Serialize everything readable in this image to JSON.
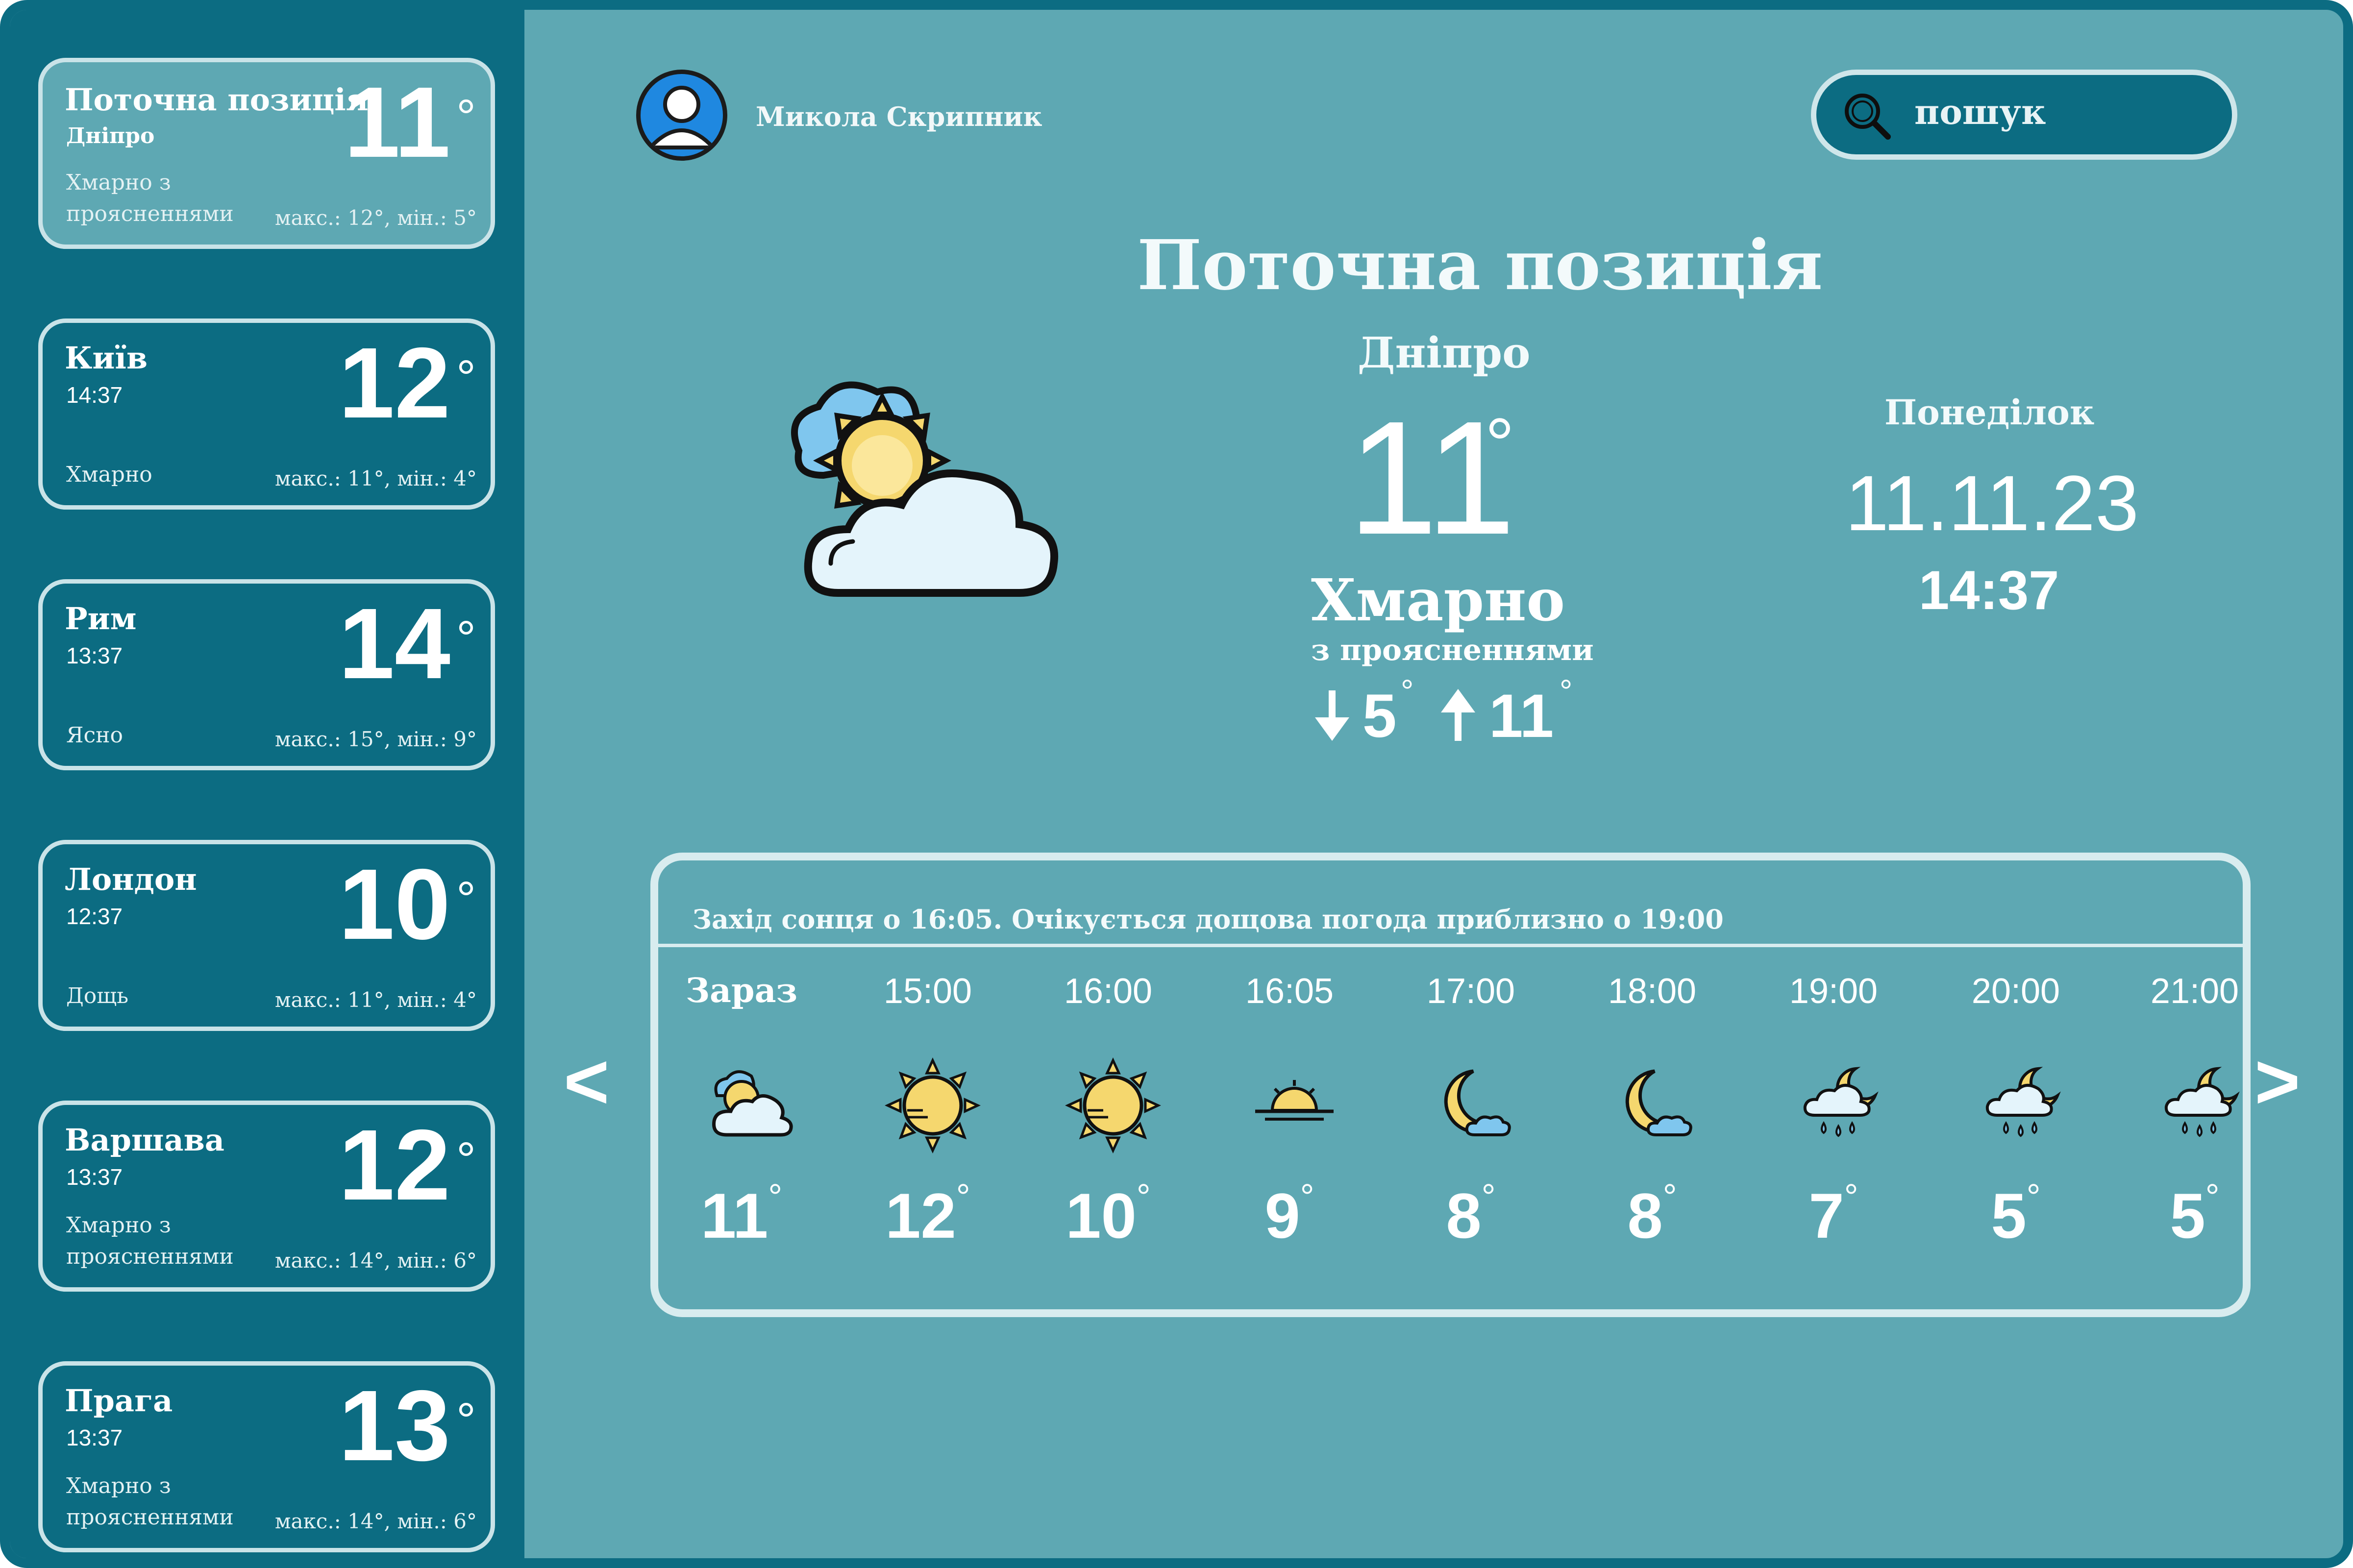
{
  "user": {
    "name": "Микола Скрипник"
  },
  "search": {
    "placeholder": "пошук"
  },
  "current": {
    "title": "Поточна позиція",
    "city": "Дніпро",
    "temp": "11",
    "condition": "Хмарно",
    "condition_detail": "з проясненнями",
    "min": "5",
    "max": "11",
    "day": "Понеділок",
    "date": "11.11.23",
    "time": "14:37",
    "icon": "sun-behind-cloud-icon"
  },
  "cities": [
    {
      "name": "Поточна позиція",
      "sub": "Дніпро",
      "temp": "11",
      "condition": "Хмарно з проясненнями",
      "range": "макс.: 12°, мін.: 5°"
    },
    {
      "name": "Київ",
      "sub": "14:37",
      "temp": "12",
      "condition": "Хмарно",
      "range": "макс.: 11°, мін.: 4°"
    },
    {
      "name": "Рим",
      "sub": "13:37",
      "temp": "14",
      "condition": "Ясно",
      "range": "макс.: 15°, мін.: 9°"
    },
    {
      "name": "Лондон",
      "sub": "12:37",
      "temp": "10",
      "condition": "Дощь",
      "range": "макс.: 11°, мін.: 4°"
    },
    {
      "name": "Варшава",
      "sub": "13:37",
      "temp": "12",
      "condition": "Хмарно з проясненнями",
      "range": "макс.: 14°, мін.: 6°"
    },
    {
      "name": "Прага",
      "sub": "13:37",
      "temp": "13",
      "condition": "Хмарно з проясненнями",
      "range": "макс.: 14°, мін.: 6°"
    }
  ],
  "hourly": {
    "note": "Захід сонця о 16:05.  Очікується дощова погода приблизно о 19:00",
    "prev_label": "<",
    "next_label": ">",
    "items": [
      {
        "time": "Зараз",
        "temp": "11",
        "icon": "sun-behind-cloud-icon"
      },
      {
        "time": "15:00",
        "temp": "12",
        "icon": "sun-icon"
      },
      {
        "time": "16:00",
        "temp": "10",
        "icon": "sun-icon"
      },
      {
        "time": "16:05",
        "temp": "9",
        "icon": "sunset-icon"
      },
      {
        "time": "17:00",
        "temp": "8",
        "icon": "moon-cloud-icon"
      },
      {
        "time": "18:00",
        "temp": "8",
        "icon": "moon-cloud-icon"
      },
      {
        "time": "19:00",
        "temp": "7",
        "icon": "moon-rain-icon"
      },
      {
        "time": "20:00",
        "temp": "5",
        "icon": "moon-rain-icon"
      },
      {
        "time": "21:00",
        "temp": "5",
        "icon": "moon-rain-icon"
      }
    ]
  },
  "colors": {
    "sidebar": "#0c6c82",
    "main": "#5ea8b3",
    "accent_border": "#c9e3e8"
  }
}
